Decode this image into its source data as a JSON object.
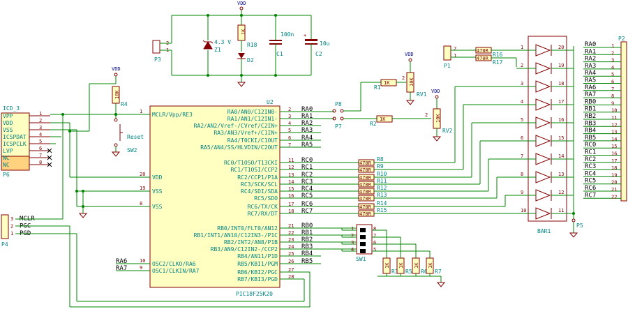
{
  "ic": {
    "ref": "U2",
    "value": "PIC18F25K20",
    "pins_left": [
      {
        "num": "1",
        "name": "MCLR/Vpp/RE3"
      },
      {
        "num": "20",
        "name": "VDD"
      },
      {
        "num": "19",
        "name": "VSS"
      },
      {
        "num": "8",
        "name": "VSS"
      },
      {
        "num": "10",
        "name": "OSC2/CLKO/RA6"
      },
      {
        "num": "9",
        "name": "OSC1/CLKIN/RA7"
      }
    ],
    "pins_right": [
      {
        "num": "2",
        "name": "RA0/AN0/C12IN0-",
        "net": "RA0"
      },
      {
        "num": "3",
        "name": "RA1/AN1/C12IN1-",
        "net": "RA1"
      },
      {
        "num": "4",
        "name": "RA2/AN2/Vref-/CVref/C2IN+",
        "net": "RA2"
      },
      {
        "num": "5",
        "name": "RA3/AN3/Vref+/C1IN+",
        "net": "RA3"
      },
      {
        "num": "6",
        "name": "RA4/T0CKI/C1OUT",
        "net": "RA4"
      },
      {
        "num": "7",
        "name": "RA5/AN4/SS/HLVDIN/C2OUT",
        "net": "RA5"
      },
      {
        "num": "11",
        "name": "RC0/T1OSO/T13CKI",
        "net": "RC0"
      },
      {
        "num": "12",
        "name": "RC1/T1OSI/CCP2",
        "net": "RC1"
      },
      {
        "num": "13",
        "name": "RC2/CCP1/P1A",
        "net": "RC2"
      },
      {
        "num": "14",
        "name": "RC3/SCK/SCL",
        "net": "RC3"
      },
      {
        "num": "15",
        "name": "RC4/SDI/SDA",
        "net": "RC4"
      },
      {
        "num": "16",
        "name": "RC5/SDO",
        "net": "RC5"
      },
      {
        "num": "17",
        "name": "RC6/TX/CK",
        "net": "RC6"
      },
      {
        "num": "18",
        "name": "RC7/RX/DT",
        "net": "RC7"
      },
      {
        "num": "21",
        "name": "RB0/INT0/FLT0/AN12",
        "net": "RB0"
      },
      {
        "num": "22",
        "name": "RB1/INT1/AN10/C12IN3-/P1C",
        "net": "RB1"
      },
      {
        "num": "23",
        "name": "RB2/INT2/AN8/P1B",
        "net": "RB2"
      },
      {
        "num": "24",
        "name": "RB3/AN9/C12IN2-/CCP2",
        "net": "RB3"
      },
      {
        "num": "25",
        "name": "RB4/AN11/P1D",
        "net": "RB4"
      },
      {
        "num": "26",
        "name": "RB5/KBI1/PGM",
        "net": "RB5"
      },
      {
        "num": "27",
        "name": "RB6/KBI2/PGC",
        "net": ""
      },
      {
        "num": "28",
        "name": "RB7/KBI3/PGD",
        "net": ""
      }
    ],
    "left_nets": [
      "RA6",
      "RA7"
    ]
  },
  "icd": {
    "ref": "ICD_3",
    "conn": "P6",
    "pins": [
      {
        "num": "1",
        "name": "VPP"
      },
      {
        "num": "2",
        "name": "VDD"
      },
      {
        "num": "3",
        "name": "VSS"
      },
      {
        "num": "4",
        "name": "ICSPDAT"
      },
      {
        "num": "5",
        "name": "ICSPCLK"
      },
      {
        "num": "6",
        "name": "LVP"
      },
      {
        "num": "7",
        "name": "NC"
      },
      {
        "num": "8",
        "name": "NC"
      }
    ]
  },
  "p4": {
    "ref": "P4",
    "pins": [
      {
        "num": "3",
        "name": "MCLR"
      },
      {
        "num": "2",
        "name": "PGC"
      },
      {
        "num": "1",
        "name": "PGD"
      }
    ]
  },
  "power": {
    "vdd": "VDD",
    "zener": {
      "ref": "Z1",
      "value": "4.3 V"
    },
    "r18": {
      "ref": "R18",
      "value": "1K"
    },
    "d2": "D2",
    "c1": {
      "ref": "C1",
      "value": "100n"
    },
    "c2": {
      "ref": "C2",
      "value": "10u"
    },
    "p3": "P3",
    "p3_pins": [
      "2",
      "1"
    ]
  },
  "reset": {
    "r4": {
      "ref": "R4",
      "value": "10K"
    },
    "sw": {
      "ref": "SW2",
      "label": "Reset"
    }
  },
  "pots": {
    "rv1": {
      "ref": "RV1",
      "value": "10K"
    },
    "rv2": {
      "ref": "RV2",
      "value": "10K"
    },
    "r1": {
      "ref": "R1",
      "value": "1K"
    },
    "r2": {
      "ref": "R2",
      "value": "1K"
    },
    "p8": "P8",
    "p7": "P7",
    "wiper_pin": "2"
  },
  "leds": {
    "bar": "BAR1",
    "res_value": "470R",
    "res_refs": [
      "R8",
      "R9",
      "R10",
      "R11",
      "R12",
      "R13",
      "R14",
      "R15"
    ],
    "left_pins": [
      "1",
      "2",
      "3",
      "4",
      "5",
      "6",
      "7",
      "8",
      "9",
      "10"
    ],
    "right_pins": [
      "20",
      "19",
      "18",
      "17",
      "16",
      "15",
      "14",
      "13",
      "12",
      "11"
    ],
    "r16": "R16",
    "r17": "R17",
    "p1": "P1",
    "p1_pins": [
      "2",
      "1"
    ],
    "p5": "P5"
  },
  "dip": {
    "ref": "SW1",
    "left_pins": [
      "1",
      "2",
      "3",
      "4"
    ],
    "right_pins": [
      "8",
      "7",
      "6",
      "5"
    ],
    "res_value": "1K",
    "res_refs": [
      "R3",
      "R5",
      "R6",
      "R7"
    ]
  },
  "p2": {
    "ref": "P2",
    "nets": [
      "RA0",
      "RA1",
      "RA2",
      "RA3",
      "RA4",
      "RA5",
      "RA6",
      "RA7",
      "RB0",
      "RB1",
      "RB2",
      "RB3",
      "RB4",
      "RB5",
      "RC0",
      "RC1",
      "RC2",
      "RC3",
      "RC4",
      "RC5",
      "RC6",
      "RC7"
    ],
    "pins": [
      "1",
      "2",
      "3",
      "4",
      "5",
      "6",
      "7",
      "8",
      "9",
      "10",
      "11",
      "12",
      "13",
      "14",
      "15",
      "16",
      "17",
      "18",
      "19",
      "20",
      "21",
      "22"
    ]
  }
}
